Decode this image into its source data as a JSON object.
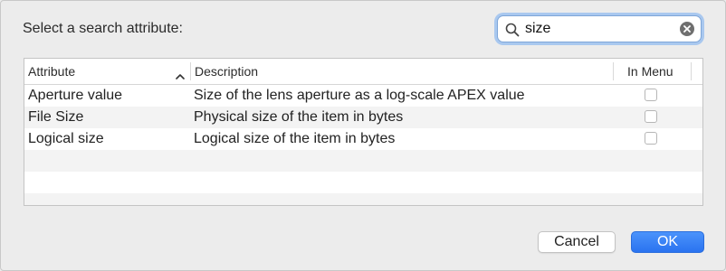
{
  "dialog": {
    "prompt": "Select a search attribute:"
  },
  "search": {
    "value": "size",
    "placeholder": ""
  },
  "table": {
    "columns": {
      "attribute": "Attribute",
      "description": "Description",
      "in_menu": "In Menu"
    },
    "sort": "ascending",
    "rows": [
      {
        "attribute": "Aperture value",
        "description": "Size of the lens aperture as a log-scale APEX value",
        "in_menu": false
      },
      {
        "attribute": "File Size",
        "description": "Physical size of the item in bytes",
        "in_menu": false
      },
      {
        "attribute": "Logical size",
        "description": "Logical size of the item in bytes",
        "in_menu": false
      }
    ]
  },
  "buttons": {
    "cancel": "Cancel",
    "ok": "OK"
  },
  "colors": {
    "accent": "#2e7bf6",
    "focus_ring": "#a9c8ef",
    "background": "#ececec"
  },
  "icons": {
    "search": "magnifying-glass-icon",
    "clear": "clear-circle-icon",
    "sort": "chevron-up-icon"
  }
}
